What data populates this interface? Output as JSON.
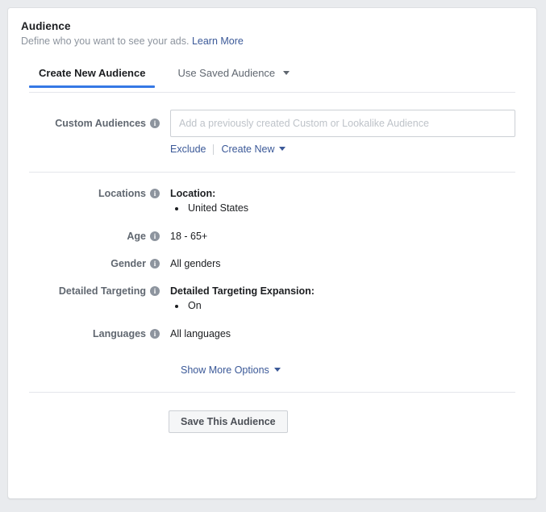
{
  "panel": {
    "title": "Audience",
    "subtitle": "Define who you want to see your ads.",
    "learn_more": "Learn More"
  },
  "tabs": [
    {
      "label": "Create New Audience",
      "active": true
    },
    {
      "label": "Use Saved Audience",
      "active": false
    }
  ],
  "custom_audiences": {
    "label": "Custom Audiences",
    "placeholder": "Add a previously created Custom or Lookalike Audience",
    "value": "",
    "exclude_link": "Exclude",
    "create_new_link": "Create New"
  },
  "fields": {
    "locations": {
      "label": "Locations",
      "value_head": "Location:",
      "bullets": [
        "United States"
      ]
    },
    "age": {
      "label": "Age",
      "value": "18 - 65+"
    },
    "gender": {
      "label": "Gender",
      "value": "All genders"
    },
    "detailed_targeting": {
      "label": "Detailed Targeting",
      "value_head": "Detailed Targeting Expansion:",
      "bullets": [
        "On"
      ]
    },
    "languages": {
      "label": "Languages",
      "value": "All languages"
    }
  },
  "show_more_options": "Show More Options",
  "save_button": "Save This Audience",
  "icons": {
    "info": "i",
    "caret_down": "caret-down-icon"
  },
  "colors": {
    "accent_blue": "#3578e5",
    "link_blue": "#3b5998",
    "label_gray": "#606770",
    "border_gray": "#e4e6eb",
    "page_bg": "#e9ebee"
  }
}
